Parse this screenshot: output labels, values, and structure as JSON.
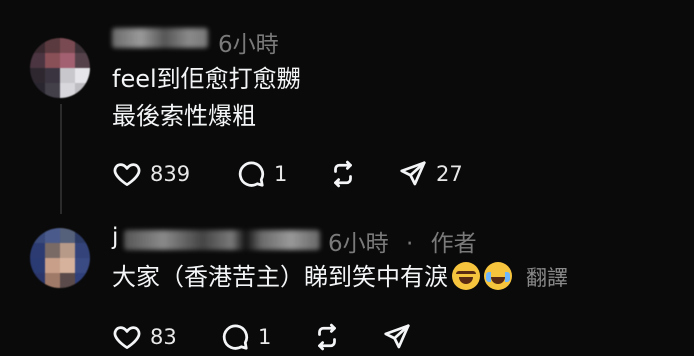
{
  "comments": [
    {
      "time": "6小時",
      "lines": [
        "feel到佢愈打愈嬲",
        "最後索性爆粗"
      ],
      "likes": "839",
      "replies": "1",
      "shares": "27"
    },
    {
      "username_initial": "j",
      "time": "6小時",
      "separator": "·",
      "author_badge": "作者",
      "text": "大家（香港苦主）睇到笑中有淚",
      "emojis": [
        "tears-of-joy-emoji",
        "crying-face-emoji"
      ],
      "translate_label": "翻譯",
      "likes": "83",
      "replies": "1"
    }
  ],
  "colors": {
    "background": "#0a0a0a",
    "text": "#f3f5f7",
    "muted": "#7a7a7a"
  },
  "icons": [
    "heart-icon",
    "comment-icon",
    "repost-icon",
    "share-icon"
  ]
}
